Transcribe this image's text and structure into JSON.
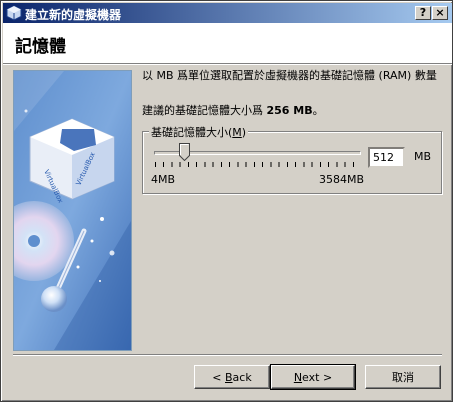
{
  "window": {
    "title": "建立新的虛擬機器",
    "help_button": "?",
    "close_button": "×"
  },
  "page": {
    "title": "記憶體",
    "description": "以 MB 爲單位選取配置於虛擬機器的基礎記憶體 (RAM) 數量",
    "recommend_prefix": "建議的基礎記憶體大小爲 ",
    "recommend_value": "256 MB",
    "recommend_suffix": "。"
  },
  "memory": {
    "group_label": "基礎記憶體大小",
    "group_mnemonic": "M",
    "value": "512",
    "unit": "MB",
    "min_label": "4MB",
    "max_label": "3584MB",
    "min": 4,
    "max": 3584,
    "current": 512
  },
  "buttons": {
    "back_prefix": "< ",
    "back_mnemonic": "B",
    "back_rest": "ack",
    "next_mnemonic": "N",
    "next_rest": "ext >",
    "cancel": "取消"
  },
  "icons": {
    "app": "virtualbox-icon",
    "side_image": "virtualbox-cube-illustration"
  }
}
